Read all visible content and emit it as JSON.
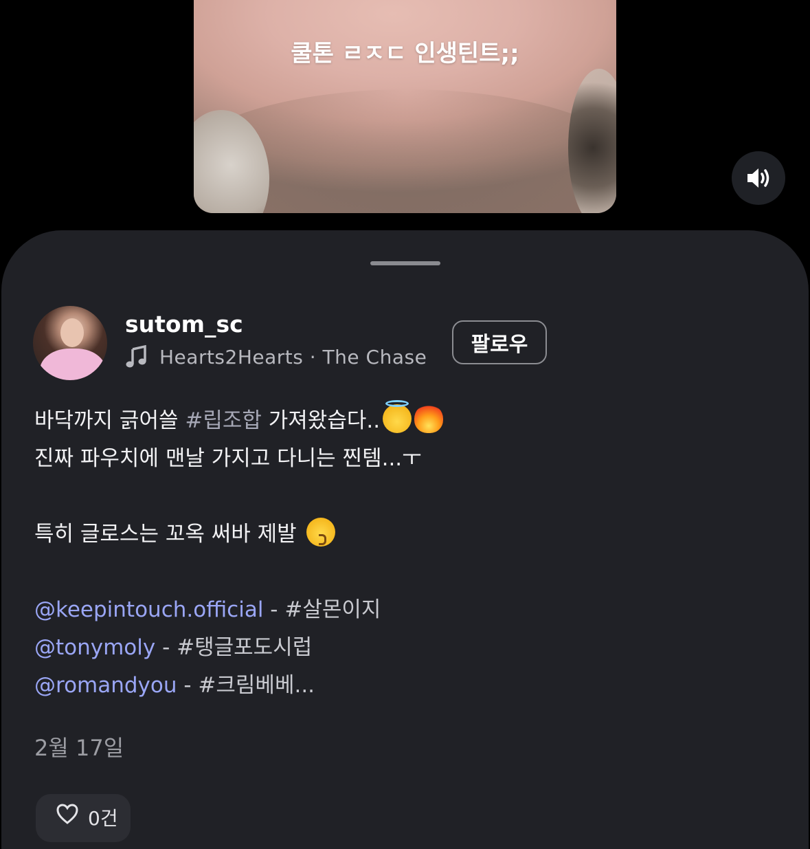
{
  "video": {
    "caption": "쿨톤 ㄹㅈㄷ 인생틴트;;",
    "sound_icon": "speaker-on-icon"
  },
  "sheet": {
    "author": {
      "username": "sutom_sc",
      "music_icon": "music-note-icon",
      "music": "Hearts2Hearts · The Chase"
    },
    "follow_label": "팔로우",
    "caption": {
      "line1_a": "바닥까지 긁어쓸 ",
      "line1_tag": "#립조합",
      "line1_b": " 가져왔습다..",
      "line2": "진짜 파우치에 맨날 가지고 다니는 찐템...ㅜ",
      "line3": "특히 글로스는 꼬옥 써바 제발 ",
      "mentions": [
        {
          "handle": "@keepintouch.official",
          "tag": " - #살몬이지"
        },
        {
          "handle": "@tonymoly",
          "tag": " - #탱글포도시럽"
        },
        {
          "handle": "@romandyou",
          "tag": " - #크림베베..."
        }
      ]
    },
    "date": "2월 17일",
    "like_pill": {
      "icon": "heart-icon",
      "count": "0건"
    }
  }
}
